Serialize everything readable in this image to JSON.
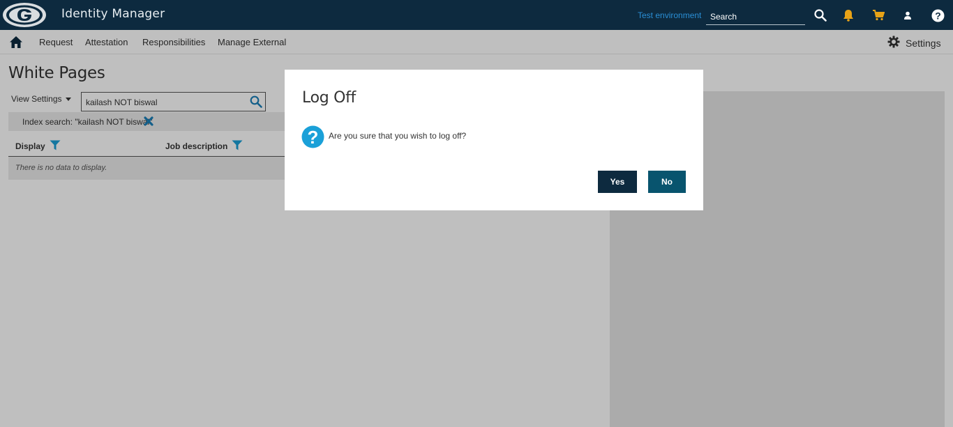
{
  "header": {
    "app_title": "Identity Manager",
    "environment": "Test environment",
    "search_placeholder": "Search",
    "icons": [
      "logo-icon",
      "search-icon",
      "bell-icon",
      "cart-icon",
      "user-icon",
      "help-icon"
    ],
    "colors": {
      "bar": "#0d2a3f",
      "env_link": "#2a8fd6",
      "bell": "#e8a317",
      "cart": "#e8a317"
    }
  },
  "nav": {
    "items": [
      {
        "label": "Request"
      },
      {
        "label": "Attestation"
      },
      {
        "label": "Responsibilities"
      },
      {
        "label": "Manage External"
      }
    ],
    "settings_label": "Settings"
  },
  "page": {
    "title": "White Pages",
    "view_settings_label": "View Settings",
    "search_value": "kailash NOT biswal",
    "index_search": "Index search: \"kailash NOT biswal\"",
    "columns": [
      "Display",
      "Job description"
    ],
    "empty_message": "There is no data to display."
  },
  "dialog": {
    "title": "Log Off",
    "message": "Are you sure that you wish to log off?",
    "yes_label": "Yes",
    "no_label": "No",
    "colors": {
      "yes": "#0d2a3f",
      "no": "#08546e",
      "question_icon": "#1aa0d8"
    }
  }
}
